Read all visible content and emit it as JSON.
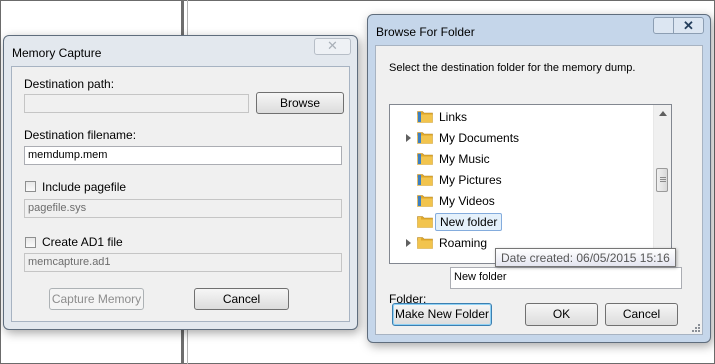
{
  "memory_capture": {
    "title": "Memory Capture",
    "close_icon": "close-icon",
    "destination_path_label": "Destination path:",
    "destination_path_value": "",
    "browse_label": "Browse",
    "destination_filename_label": "Destination filename:",
    "destination_filename_value": "memdump.mem",
    "include_pagefile_label": "Include pagefile",
    "include_pagefile_checked": false,
    "pagefile_value": "pagefile.sys",
    "create_ad1_label": "Create AD1 file",
    "create_ad1_checked": false,
    "ad1_value": "memcapture.ad1",
    "capture_button_label": "Capture Memory",
    "cancel_button_label": "Cancel"
  },
  "browse_for_folder": {
    "title": "Browse For Folder",
    "instruction": "Select the destination folder for the memory dump.",
    "tree_items": [
      {
        "label": "Links",
        "expandable": false,
        "selected": false,
        "icon": "links-folder-icon"
      },
      {
        "label": "My Documents",
        "expandable": true,
        "selected": false,
        "icon": "documents-folder-icon"
      },
      {
        "label": "My Music",
        "expandable": false,
        "selected": false,
        "icon": "music-folder-icon"
      },
      {
        "label": "My Pictures",
        "expandable": false,
        "selected": false,
        "icon": "pictures-folder-icon"
      },
      {
        "label": "My Videos",
        "expandable": false,
        "selected": false,
        "icon": "videos-folder-icon"
      },
      {
        "label": "New folder",
        "expandable": false,
        "selected": true,
        "icon": "folder-icon"
      },
      {
        "label": "Roaming",
        "expandable": true,
        "selected": false,
        "icon": "folder-icon"
      }
    ],
    "tooltip": "Date created: 06/05/2015 15:16",
    "folder_label": "Folder:",
    "folder_value": "New folder",
    "make_new_folder_label": "Make New Folder",
    "ok_label": "OK",
    "cancel_label": "Cancel"
  },
  "colors": {
    "folder_yellow": "#f2c44d",
    "selection_bg": "#e5f1fb",
    "selection_border": "#84acdd",
    "window_frame": "#c5d6ea"
  }
}
